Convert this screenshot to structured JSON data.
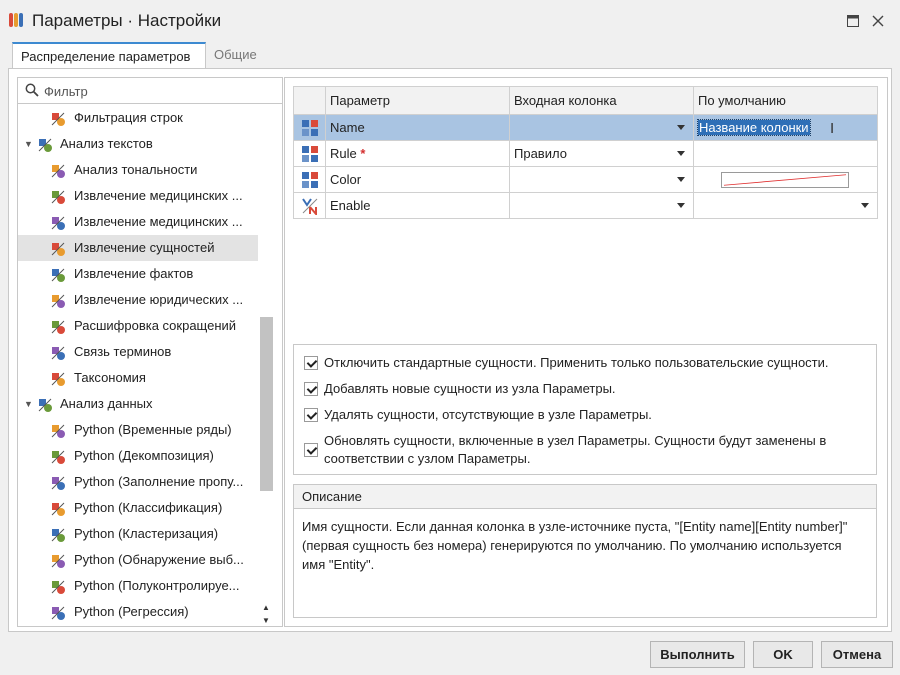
{
  "window": {
    "title": "Параметры · Настройки",
    "maximize_glyph": "🗖",
    "close_glyph": "✕"
  },
  "tabs": [
    {
      "label": "Распределение параметров",
      "active": true
    },
    {
      "label": "Общие",
      "active": false
    }
  ],
  "filter": {
    "placeholder": "Фильтр",
    "value": ""
  },
  "tree": [
    {
      "level": 2,
      "label": "Фильтрация строк",
      "icon": "row-filter-icon"
    },
    {
      "level": 1,
      "label": "Анализ текстов",
      "icon": "text-analysis-icon",
      "expanded": true
    },
    {
      "level": 2,
      "label": "Анализ тональности",
      "icon": "sentiment-icon"
    },
    {
      "level": 2,
      "label": "Извлечение медицинских ...",
      "icon": "medical-extraction-icon"
    },
    {
      "level": 2,
      "label": "Извлечение медицинских ...",
      "icon": "medical-extraction-icon"
    },
    {
      "level": 2,
      "label": "Извлечение сущностей",
      "icon": "entity-extraction-icon",
      "selected": true
    },
    {
      "level": 2,
      "label": "Извлечение фактов",
      "icon": "fact-extraction-icon"
    },
    {
      "level": 2,
      "label": "Извлечение юридических ...",
      "icon": "legal-extraction-icon"
    },
    {
      "level": 2,
      "label": "Расшифровка сокращений",
      "icon": "abbreviation-icon"
    },
    {
      "level": 2,
      "label": "Связь терминов",
      "icon": "term-link-icon"
    },
    {
      "level": 2,
      "label": "Таксономия",
      "icon": "taxonomy-icon"
    },
    {
      "level": 1,
      "label": "Анализ данных",
      "icon": "data-analysis-icon",
      "expanded": true
    },
    {
      "level": 2,
      "label": "Python (Временные ряды)",
      "icon": "python-icon"
    },
    {
      "level": 2,
      "label": "Python (Декомпозиция)",
      "icon": "python-icon"
    },
    {
      "level": 2,
      "label": "Python (Заполнение пропу...",
      "icon": "python-icon"
    },
    {
      "level": 2,
      "label": "Python (Классификация)",
      "icon": "python-icon"
    },
    {
      "level": 2,
      "label": "Python (Кластеризация)",
      "icon": "python-icon"
    },
    {
      "level": 2,
      "label": "Python (Обнаружение выб...",
      "icon": "python-icon"
    },
    {
      "level": 2,
      "label": "Python (Полуконтролируе...",
      "icon": "python-icon"
    },
    {
      "level": 2,
      "label": "Python (Регрессия)",
      "icon": "python-icon"
    }
  ],
  "grid": {
    "headers": [
      "Параметр",
      "Входная колонка",
      "По умолчанию"
    ],
    "rows": [
      {
        "icon": "variable-icon",
        "param": "Name",
        "input": "",
        "default": "Название колонки",
        "editing": true
      },
      {
        "icon": "variable-icon",
        "param": "Rule",
        "required_mark": "*",
        "input": "Правило",
        "default": ""
      },
      {
        "icon": "variable-icon",
        "param": "Color",
        "input": "",
        "default": ""
      },
      {
        "icon": "boolean-icon",
        "param": "Enable",
        "input": "",
        "default": ""
      }
    ]
  },
  "options": [
    {
      "checked": true,
      "label": "Отключить стандартные сущности. Применить только пользовательские сущности."
    },
    {
      "checked": true,
      "label": "Добавлять новые сущности из узла Параметры."
    },
    {
      "checked": true,
      "label": "Удалять сущности, отсутствующие в узле Параметры."
    },
    {
      "checked": true,
      "label": "Обновлять сущности, включенные в узел Параметры. Сущности будут заменены в соответствии с узлом Параметры."
    }
  ],
  "description": {
    "title": "Описание",
    "text": "Имя сущности. Если данная колонка в узле-источнике пуста, \"[Entity name][Entity number]\" (первая сущность без номера) генерируются по умолчанию. По умолчанию используется имя \"Entity\"."
  },
  "buttons": {
    "run": "Выполнить",
    "ok": "OK",
    "cancel": "Отмена"
  },
  "colors": {
    "accent": "#3d8ad1",
    "selected_row": "#a9c4e2",
    "edit_highlight": "#2e6fb7",
    "required": "#d32f2f"
  }
}
